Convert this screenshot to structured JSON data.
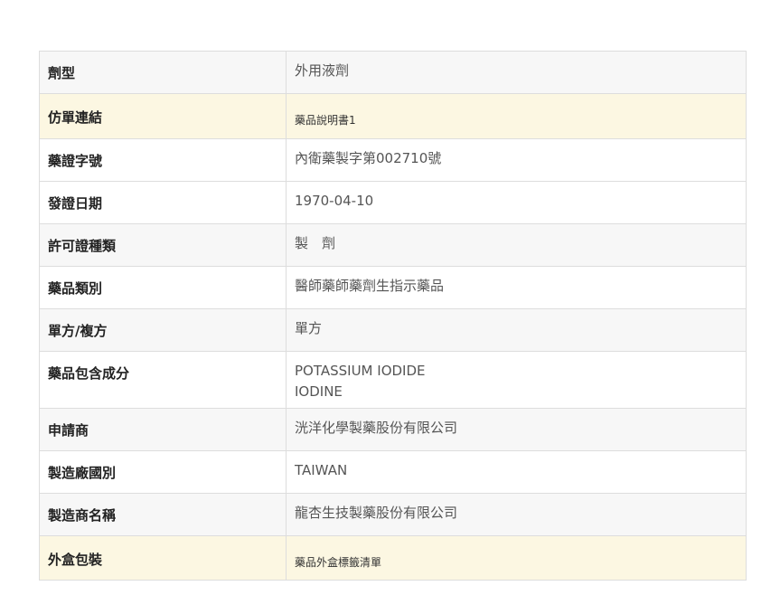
{
  "rows": [
    {
      "label": "劑型",
      "value": "外用液劑",
      "style": "gray",
      "height": 47
    },
    {
      "label": "仿單連結",
      "link": "藥品說明書1",
      "style": "yellow",
      "height": 50
    },
    {
      "label": "藥證字號",
      "value": "內衛藥製字第002710號",
      "style": "white",
      "height": 47
    },
    {
      "label": "發證日期",
      "value": "1970-04-10",
      "style": "white",
      "height": 47
    },
    {
      "label": "許可證種類",
      "value": "製　劑",
      "style": "gray",
      "height": 47
    },
    {
      "label": "藥品類別",
      "value": "醫師藥師藥劑生指示藥品",
      "style": "white",
      "height": 47
    },
    {
      "label": "單方/複方",
      "value": "單方",
      "style": "gray",
      "height": 47
    },
    {
      "label": "藥品包含成分",
      "values": [
        "POTASSIUM IODIDE",
        "IODINE"
      ],
      "style": "white",
      "height": 63
    },
    {
      "label": "申請商",
      "value": "洸洋化學製藥股份有限公司",
      "style": "gray",
      "height": 47
    },
    {
      "label": "製造廠國別",
      "value": "TAIWAN",
      "style": "white",
      "height": 47
    },
    {
      "label": "製造商名稱",
      "value": "龍杏生技製藥股份有限公司",
      "style": "gray",
      "height": 47
    },
    {
      "label": "外盒包裝",
      "link": "藥品外盒標籤清單",
      "style": "yellow",
      "height": 49
    }
  ]
}
